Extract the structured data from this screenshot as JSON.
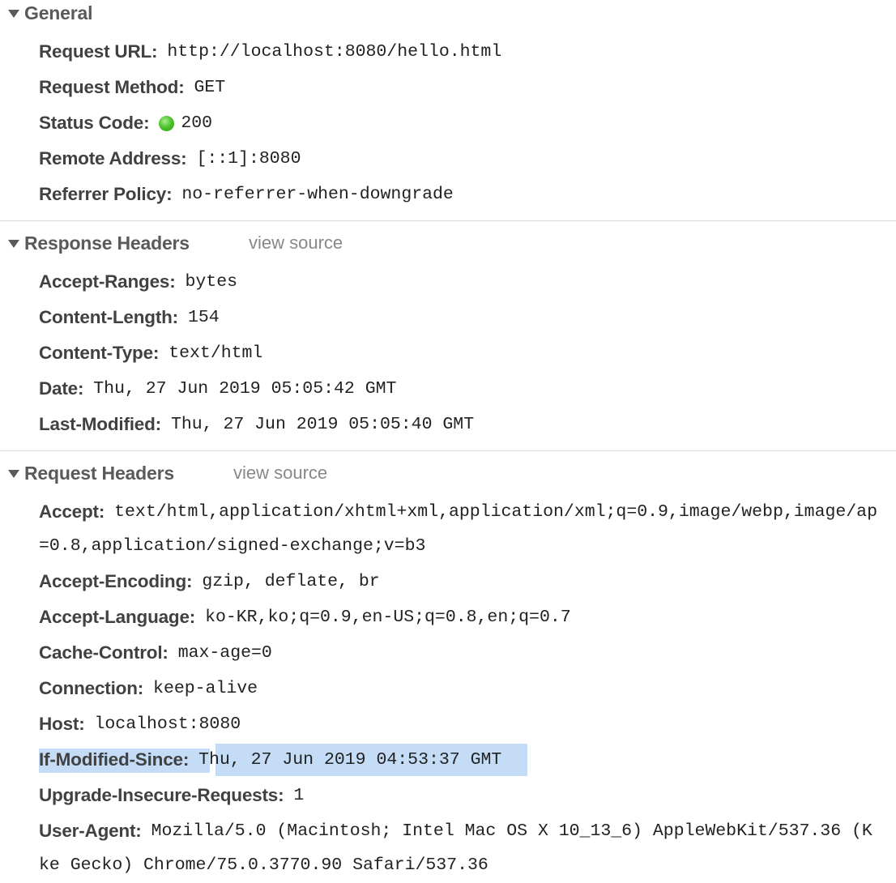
{
  "general": {
    "title": "General",
    "rows": [
      {
        "key": "Request URL:",
        "value": "http://localhost:8080/hello.html"
      },
      {
        "key": "Request Method:",
        "value": "GET"
      },
      {
        "key": "Status Code:",
        "value": "200",
        "status_color": "#3cb521"
      },
      {
        "key": "Remote Address:",
        "value": "[::1]:8080"
      },
      {
        "key": "Referrer Policy:",
        "value": "no-referrer-when-downgrade"
      }
    ]
  },
  "response_headers": {
    "title": "Response Headers",
    "view_source": "view source",
    "rows": [
      {
        "key": "Accept-Ranges:",
        "value": "bytes"
      },
      {
        "key": "Content-Length:",
        "value": "154"
      },
      {
        "key": "Content-Type:",
        "value": "text/html"
      },
      {
        "key": "Date:",
        "value": "Thu, 27 Jun 2019 05:05:42 GMT"
      },
      {
        "key": "Last-Modified:",
        "value": "Thu, 27 Jun 2019 05:05:40 GMT"
      }
    ]
  },
  "request_headers": {
    "title": "Request Headers",
    "view_source": "view source",
    "rows": [
      {
        "key": "Accept:",
        "value": "text/html,application/xhtml+xml,application/xml;q=0.9,image/webp,image/ap",
        "continuation": "=0.8,application/signed-exchange;v=b3"
      },
      {
        "key": "Accept-Encoding:",
        "value": "gzip, deflate, br"
      },
      {
        "key": "Accept-Language:",
        "value": "ko-KR,ko;q=0.9,en-US;q=0.8,en;q=0.7"
      },
      {
        "key": "Cache-Control:",
        "value": "max-age=0"
      },
      {
        "key": "Connection:",
        "value": "keep-alive"
      },
      {
        "key": "Host:",
        "value": "localhost:8080"
      },
      {
        "key": "If-Modified-Since:",
        "value": "Thu, 27 Jun 2019 04:53:37 GMT",
        "selected": true
      },
      {
        "key": "Upgrade-Insecure-Requests:",
        "value": "1"
      },
      {
        "key": "User-Agent:",
        "value": "Mozilla/5.0 (Macintosh; Intel Mac OS X 10_13_6) AppleWebKit/537.36 (K",
        "continuation": "ke Gecko) Chrome/75.0.3770.90 Safari/537.36"
      }
    ]
  },
  "colors": {
    "selection_highlight": "#c4dcf5",
    "status_ok": "#3cb521"
  }
}
